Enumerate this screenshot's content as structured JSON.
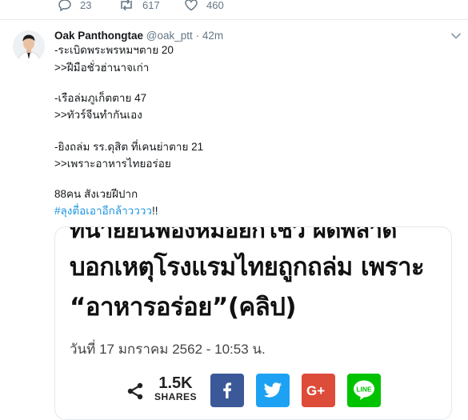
{
  "actions": {
    "reply_count": "23",
    "retweet_count": "617",
    "like_count": "460"
  },
  "tweet": {
    "author_name": "Oak Panthongtae",
    "handle": "@oak_ptt",
    "separator": "·",
    "time": "42m",
    "lines": [
      "-ระเบิดพระพรหมฯตาย 20",
      ">>ฝีมือชั่วฮ่านาจเก่า",
      "-เรือล่มภูเก็ตตาย 47",
      ">>ทัวร์จีนทำกันเอง",
      "-ยิงถล่ม รร.ดุสิต ที่เคนย่าตาย 21",
      ">>เพราะอาหารไทยอร่อย",
      "88คน สังเวยฝีปาก"
    ],
    "hashtag": "#ลุงตื่อเอาอีกล้าวววว",
    "hashtag_suffix": "!!"
  },
  "card": {
    "headline_partial": "ทนายยื่นฟ้องหมอยกโชว์ ผิดพลาด",
    "headline_line1": "บอกเหตุโรงแรมไทยถูกถล่ม เพราะ",
    "headline_line2": "“อาหารอร่อย”(คลิป)",
    "date": "วันที่ 17 มกราคม 2562 - 10:53 น.",
    "share_count": "1.5K",
    "share_label": "SHARES",
    "colors": {
      "facebook": "#3b5998",
      "twitter": "#1da1f2",
      "google_plus": "#dd4b39",
      "line": "#00c300"
    }
  }
}
